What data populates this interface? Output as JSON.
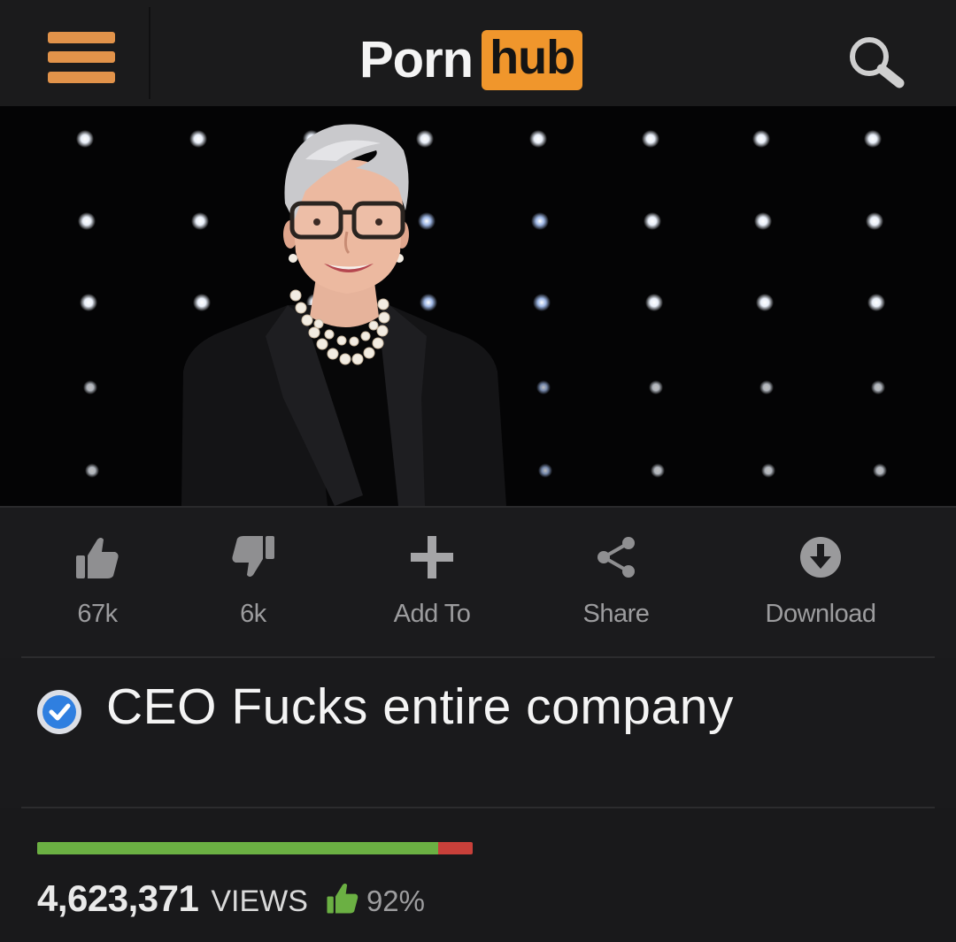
{
  "header": {
    "logo_text": "Porn",
    "logo_badge": "hub",
    "accent_color": "#f0962c",
    "menu_icon": "hamburger-menu-icon",
    "search_icon": "search-icon"
  },
  "video": {
    "description_icon": "ceo-figure"
  },
  "actions": {
    "like_count": "67k",
    "dislike_count": "6k",
    "add_to_label": "Add To",
    "share_label": "Share",
    "download_label": "Download"
  },
  "video_info": {
    "verified_color": "#2f7fe0",
    "title": "CEO Fucks entire company"
  },
  "rating": {
    "fraction": 0.92,
    "views_count": "4,623,371",
    "views_label": "VIEWS",
    "percent_label": "92%",
    "like_color": "#6bb043",
    "dislike_color": "#c8403a"
  }
}
